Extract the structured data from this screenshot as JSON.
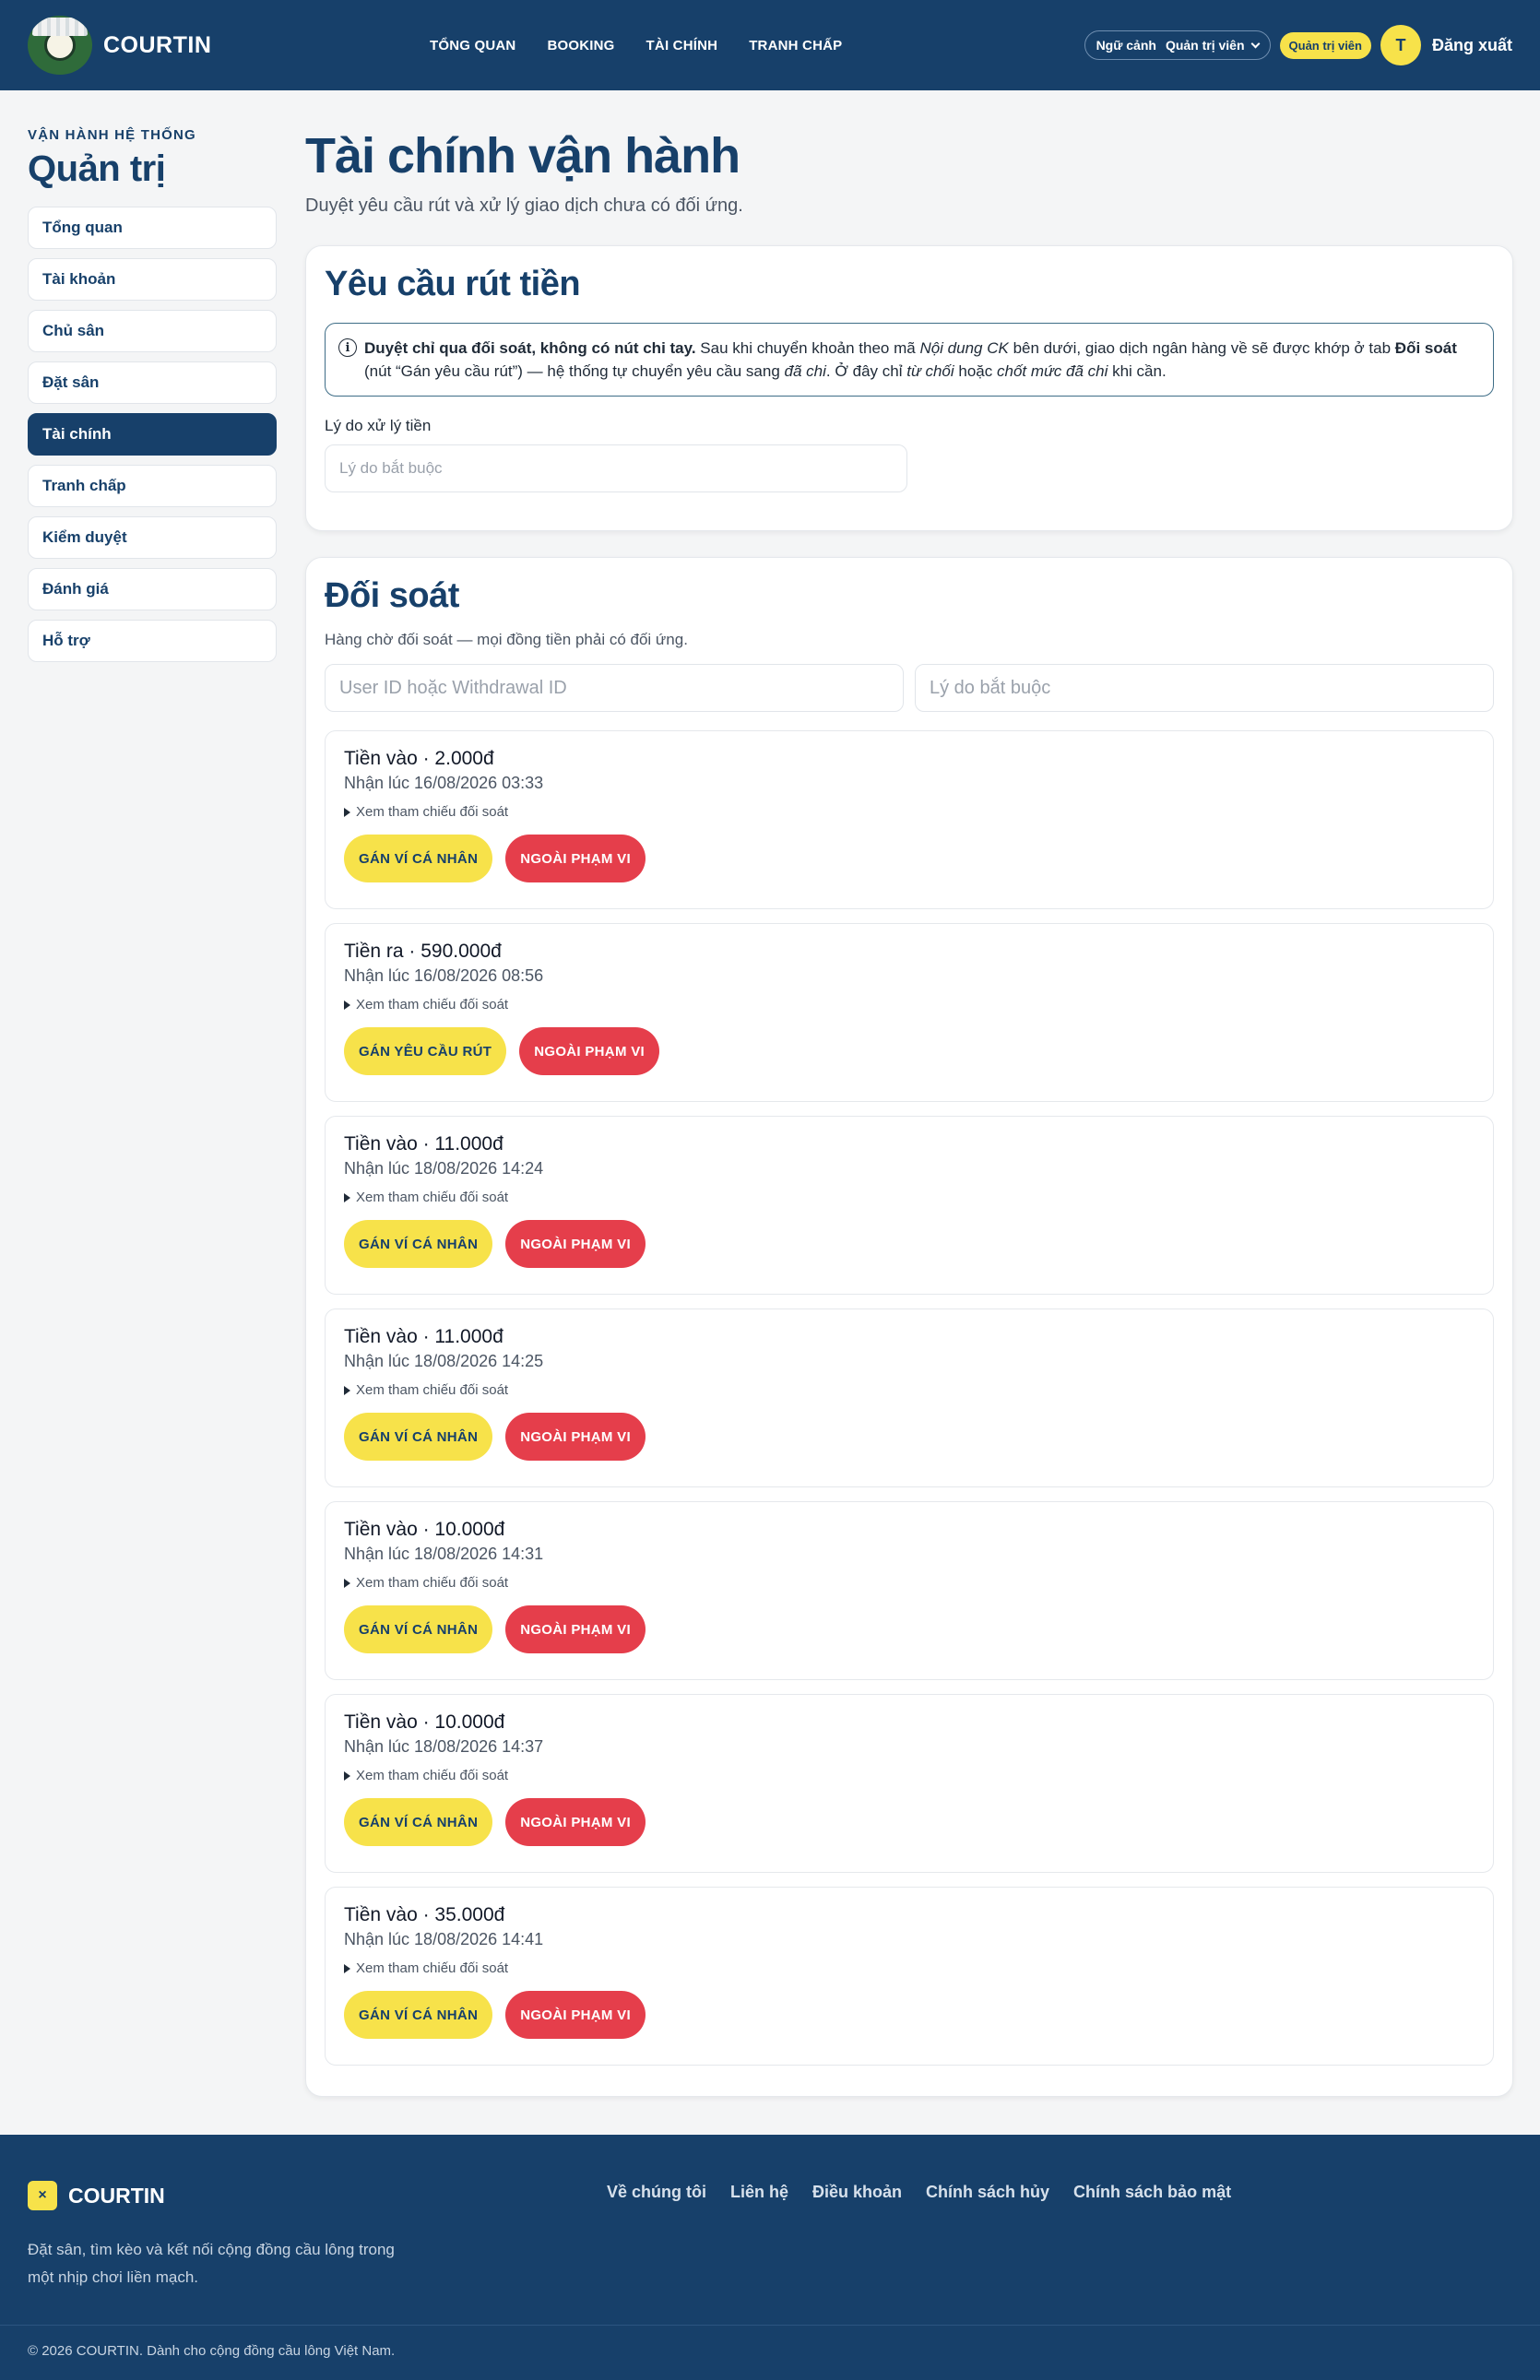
{
  "header": {
    "brand": "COURTIN",
    "nav": [
      "TỔNG QUAN",
      "BOOKING",
      "TÀI CHÍNH",
      "TRANH CHẤP"
    ],
    "context_label": "Ngữ cảnh",
    "context_value": "Quản trị viên",
    "role_badge": "Quản trị viên",
    "avatar_initial": "T",
    "logout": "Đăng xuất"
  },
  "sidebar": {
    "eyebrow": "VẬN HÀNH HỆ THỐNG",
    "title": "Quản trị",
    "items": [
      "Tổng quan",
      "Tài khoản",
      "Chủ sân",
      "Đặt sân",
      "Tài chính",
      "Tranh chấp",
      "Kiểm duyệt",
      "Đánh giá",
      "Hỗ trợ"
    ],
    "active_index": 4
  },
  "page": {
    "title": "Tài chính vận hành",
    "subtitle": "Duyệt yêu cầu rút và xử lý giao dịch chưa có đối ứng."
  },
  "withdraw": {
    "heading": "Yêu cầu rút tiền",
    "notice": {
      "b1": "Duyệt chỉ qua đối soát, không có nút chi tay.",
      "t1": " Sau khi chuyển khoản theo mã ",
      "i1": "Nội dung CK",
      "t2": " bên dưới, giao dịch ngân hàng về sẽ được khớp ở tab ",
      "b2": "Đối soát",
      "t3": " (nút “Gán yêu cầu rút”) — hệ thống tự chuyển yêu cầu sang ",
      "i2": "đã chi",
      "t4": ". Ở đây chỉ ",
      "i3": "từ chối",
      "t5": " hoặc ",
      "i4": "chốt mức đã chi",
      "t6": " khi cần."
    },
    "reason_label": "Lý do xử lý tiền",
    "reason_placeholder": "Lý do bắt buộc"
  },
  "reconcile": {
    "heading": "Đối soát",
    "subtitle": "Hàng chờ đối soát — mọi đồng tiền phải có đối ứng.",
    "search_placeholder": "User ID hoặc Withdrawal ID",
    "reason_placeholder": "Lý do bắt buộc",
    "ref_label": "Xem tham chiếu đối soát",
    "transactions": [
      {
        "title": "Tiền vào · 2.000đ",
        "time": "Nhận lúc 16/08/2026 03:33",
        "primary": "GÁN VÍ CÁ NHÂN",
        "secondary": "NGOÀI PHẠM VI"
      },
      {
        "title": "Tiền ra · 590.000đ",
        "time": "Nhận lúc 16/08/2026 08:56",
        "primary": "GÁN YÊU CẦU RÚT",
        "secondary": "NGOÀI PHẠM VI"
      },
      {
        "title": "Tiền vào · 11.000đ",
        "time": "Nhận lúc 18/08/2026 14:24",
        "primary": "GÁN VÍ CÁ NHÂN",
        "secondary": "NGOÀI PHẠM VI"
      },
      {
        "title": "Tiền vào · 11.000đ",
        "time": "Nhận lúc 18/08/2026 14:25",
        "primary": "GÁN VÍ CÁ NHÂN",
        "secondary": "NGOÀI PHẠM VI"
      },
      {
        "title": "Tiền vào · 10.000đ",
        "time": "Nhận lúc 18/08/2026 14:31",
        "primary": "GÁN VÍ CÁ NHÂN",
        "secondary": "NGOÀI PHẠM VI"
      },
      {
        "title": "Tiền vào · 10.000đ",
        "time": "Nhận lúc 18/08/2026 14:37",
        "primary": "GÁN VÍ CÁ NHÂN",
        "secondary": "NGOÀI PHẠM VI"
      },
      {
        "title": "Tiền vào · 35.000đ",
        "time": "Nhận lúc 18/08/2026 14:41",
        "primary": "GÁN VÍ CÁ NHÂN",
        "secondary": "NGOÀI PHẠM VI"
      }
    ]
  },
  "footer": {
    "brand": "COURTIN",
    "mark": "×",
    "description": "Đặt sân, tìm kèo và kết nối cộng đồng cầu lông trong một nhịp chơi liền mạch.",
    "links": [
      "Về chúng tôi",
      "Liên hệ",
      "Điều khoản",
      "Chính sách hủy",
      "Chính sách bảo mật"
    ],
    "copyright": "© 2026 COURTIN. Dành cho cộng đồng cầu lông Việt Nam."
  },
  "colors": {
    "brand_navy": "#17406a",
    "accent_yellow": "#f7e24a",
    "danger_red": "#e53e4b"
  }
}
